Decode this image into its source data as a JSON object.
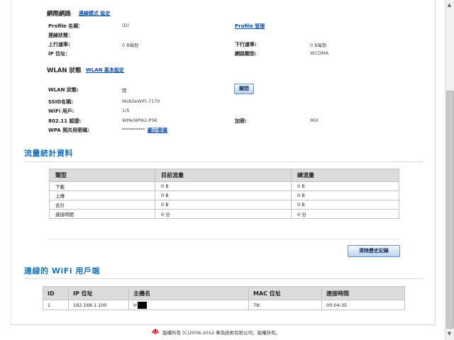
{
  "network": {
    "heading": "網際網路",
    "mode_link": "連線模式 設定",
    "profile_name_label": "Profile 名稱：",
    "profile_name_value": "(D)",
    "profile_manage_link": "Profile 管理",
    "conn_status_label": "連線狀態：",
    "upload_rate_label": "上行速率:",
    "upload_rate_value": "0 B每秒",
    "download_rate_label": "下行速率:",
    "download_rate_value": "0 B每秒",
    "ip_label": "IP 位址：",
    "net_type_label": "網路類型:",
    "net_type_value": "WCDMA"
  },
  "wlan": {
    "heading": "WLAN 狀態",
    "basic_link": "WLAN 基本設定",
    "status_label": "WLAN 狀態:",
    "status_value": "開",
    "close_button": "關閉",
    "ssid_label": "SSID名稱:",
    "ssid_value": "MobileWiFi-7170",
    "users_label": "WiFi 用戶:",
    "users_value": "1/5",
    "auth_label": "802.11 認證:",
    "auth_value": "WPA/WPA2-PSK",
    "enc_label": "加密:",
    "enc_value": "MIX",
    "psk_label": "WPA 預共用密碼:",
    "psk_value": "**********",
    "show_pwd_link": "顯示密碼"
  },
  "traffic": {
    "title": "流量統計資料",
    "headers": [
      "類型",
      "目前流量",
      "總流量"
    ],
    "rows": [
      [
        "下載",
        "0 B",
        "0 B"
      ],
      [
        "上傳",
        "0 B",
        "0 B"
      ],
      [
        "合計",
        "0 B",
        "0 B"
      ],
      [
        "連接時間",
        "0 分",
        "0 分"
      ]
    ],
    "clear_button": "清除歷史記錄"
  },
  "clients": {
    "title": "連線的 WiFi 用戶端",
    "headers": [
      "ID",
      "IP 位址",
      "主機名",
      "MAC 位址",
      "連接時間"
    ],
    "rows": [
      [
        "1",
        "192.168.1.100",
        "H",
        "78:",
        "00:04:35"
      ]
    ]
  },
  "footer": {
    "copyright": "版權所有 (C)2006-2012 華為技術有限公司。版權所有。"
  },
  "colors": {
    "accent": "#1a73b8",
    "link": "#0a4fa8",
    "brand": "#e60012"
  }
}
